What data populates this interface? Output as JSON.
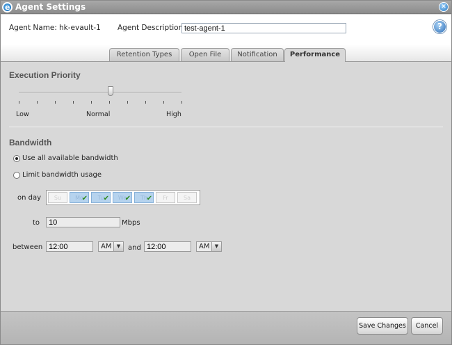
{
  "window": {
    "title": "Agent Settings",
    "logo_letter": "e"
  },
  "header": {
    "agent_name_label": "Agent Name:",
    "agent_name_value": "hk-evault-1",
    "agent_description_label": "Agent Description:",
    "agent_description_value": "test-agent-1",
    "help_label": "?"
  },
  "tabs": [
    {
      "label": "Retention Types",
      "active": false
    },
    {
      "label": "Open File",
      "active": false
    },
    {
      "label": "Notification",
      "active": false
    },
    {
      "label": "Performance",
      "active": true
    }
  ],
  "execution_priority": {
    "title": "Execution Priority",
    "labels": {
      "low": "Low",
      "normal": "Normal",
      "high": "High"
    },
    "level": 0.56
  },
  "bandwidth": {
    "title": "Bandwidth",
    "options": [
      {
        "label": "Use all available bandwidth",
        "checked": true
      },
      {
        "label": "Limit bandwidth usage",
        "checked": false
      }
    ],
    "on_day_label": "on day",
    "days": [
      {
        "label": "Su",
        "selected": false
      },
      {
        "label": "Mo",
        "selected": true
      },
      {
        "label": "Tu",
        "selected": true
      },
      {
        "label": "We",
        "selected": true
      },
      {
        "label": "Th",
        "selected": true
      },
      {
        "label": "Fr",
        "selected": false
      },
      {
        "label": "Sa",
        "selected": false
      }
    ],
    "to_label": "to",
    "to_value": "10",
    "unit": "Mbps",
    "between_label": "between",
    "start_time": "12:00",
    "start_ampm": "AM",
    "and_label": "and",
    "end_time": "12:00",
    "end_ampm": "AM"
  },
  "footer": {
    "save_label": "Save Changes",
    "cancel_label": "Cancel"
  },
  "colors": {
    "selected_day": "#b6d3ee",
    "check": "#2d8a1f",
    "accent_blue": "#2a7cc7"
  }
}
